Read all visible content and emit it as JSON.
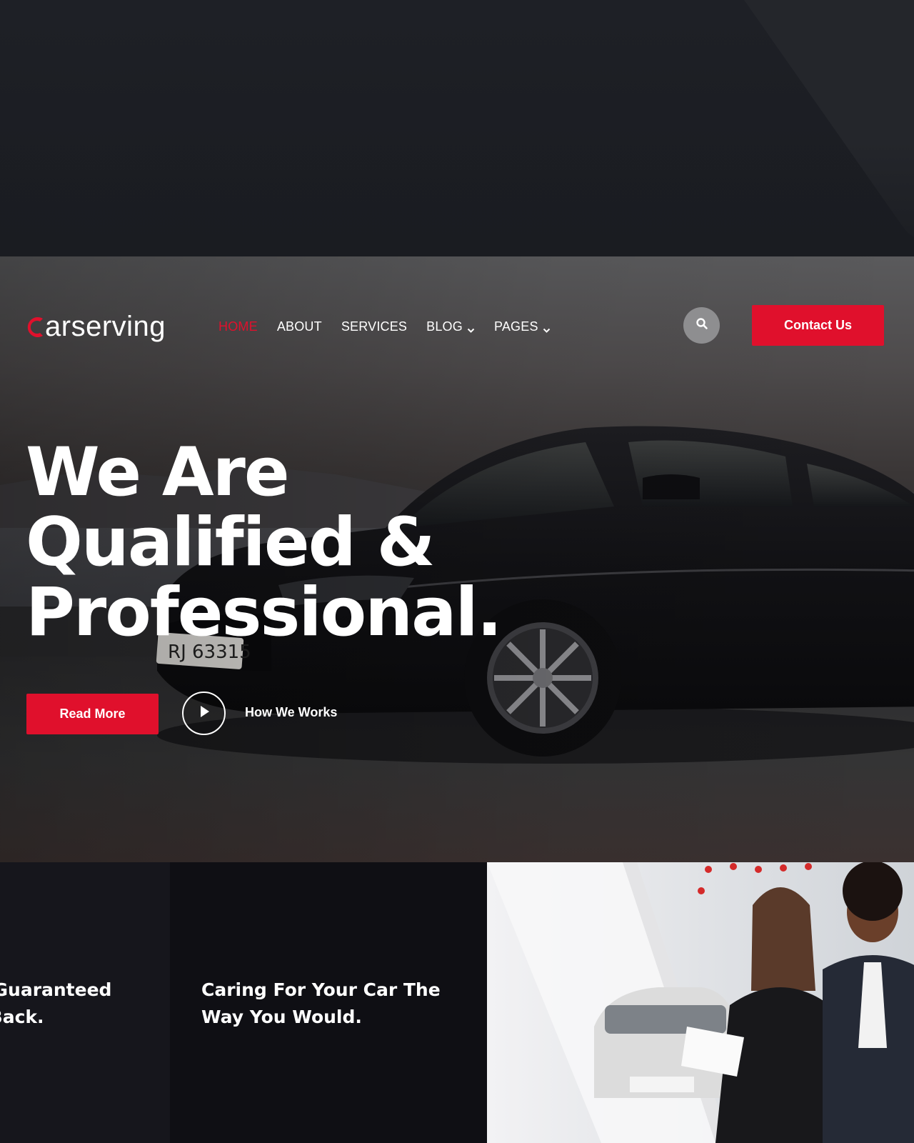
{
  "brand": {
    "logo_text": "arserving",
    "accent_color": "#e0102c"
  },
  "nav": {
    "items": [
      {
        "label": "HOME",
        "active": true,
        "dropdown": false
      },
      {
        "label": "ABOUT",
        "active": false,
        "dropdown": false
      },
      {
        "label": "SERVICES",
        "active": false,
        "dropdown": false
      },
      {
        "label": "BLOG",
        "active": false,
        "dropdown": true
      },
      {
        "label": "PAGES",
        "active": false,
        "dropdown": true
      }
    ],
    "search_icon": "search-icon",
    "contact_label": "Contact Us"
  },
  "hero": {
    "title_lines": [
      "We Are",
      "Qualified &",
      "Professional."
    ],
    "read_more_label": "Read More",
    "play_icon": "play-icon",
    "how_works_label": "How We Works"
  },
  "features": [
    {
      "title_lines": [
        "n Guaranteed",
        "t Back."
      ]
    },
    {
      "title_lines": [
        "Caring For Your Car The",
        "Way You Would."
      ]
    }
  ]
}
